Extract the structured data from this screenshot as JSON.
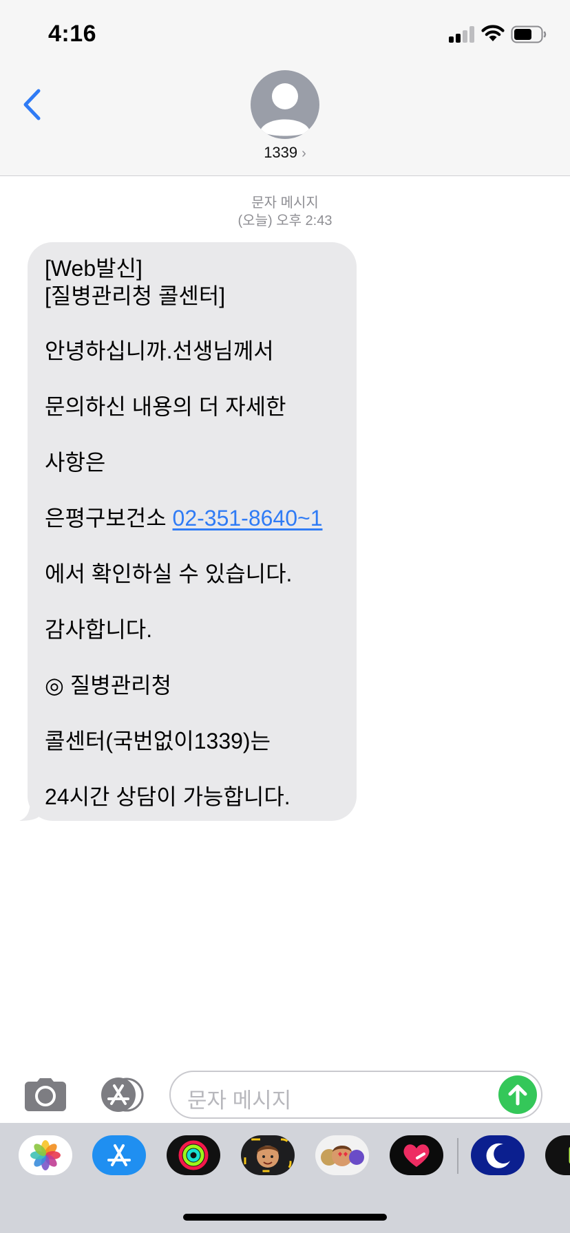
{
  "status_bar": {
    "time": "4:16"
  },
  "header": {
    "contact_name": "1339",
    "chevron": "›"
  },
  "conversation": {
    "timestamp_label": "문자 메시지",
    "timestamp_time": "(오늘) 오후 2:43",
    "message": {
      "header_lines": [
        "[Web발신]",
        "[질병관리청 콜센터]"
      ],
      "line_greeting": "안녕하십니까.선생님께서",
      "line_inquiry": "문의하신 내용의 더 자세한",
      "line_details": "사항은",
      "line_center_prefix": "은평구보건소 ",
      "phone_link": "02-351-8640~1",
      "line_confirm": "에서 확인하실 수 있습니다.",
      "line_thanks": "감사합니다.",
      "line_org": "◎ 질병관리청",
      "line_callcenter": "콜센터(국번없이1339)는",
      "line_hours": "24시간 상담이 가능합니다."
    }
  },
  "input": {
    "placeholder": "문자 메시지"
  },
  "colors": {
    "accent_blue": "#2f7bf5",
    "bubble_gray": "#e9e9eb",
    "send_green": "#34c759",
    "header_bg": "#f6f6f6"
  },
  "app_drawer": {
    "icons": [
      "photos-icon",
      "app-store-icon",
      "activity-icon",
      "memoji-icon",
      "memoji-stickers-icon",
      "digital-touch-icon",
      "sleep-icon"
    ]
  }
}
